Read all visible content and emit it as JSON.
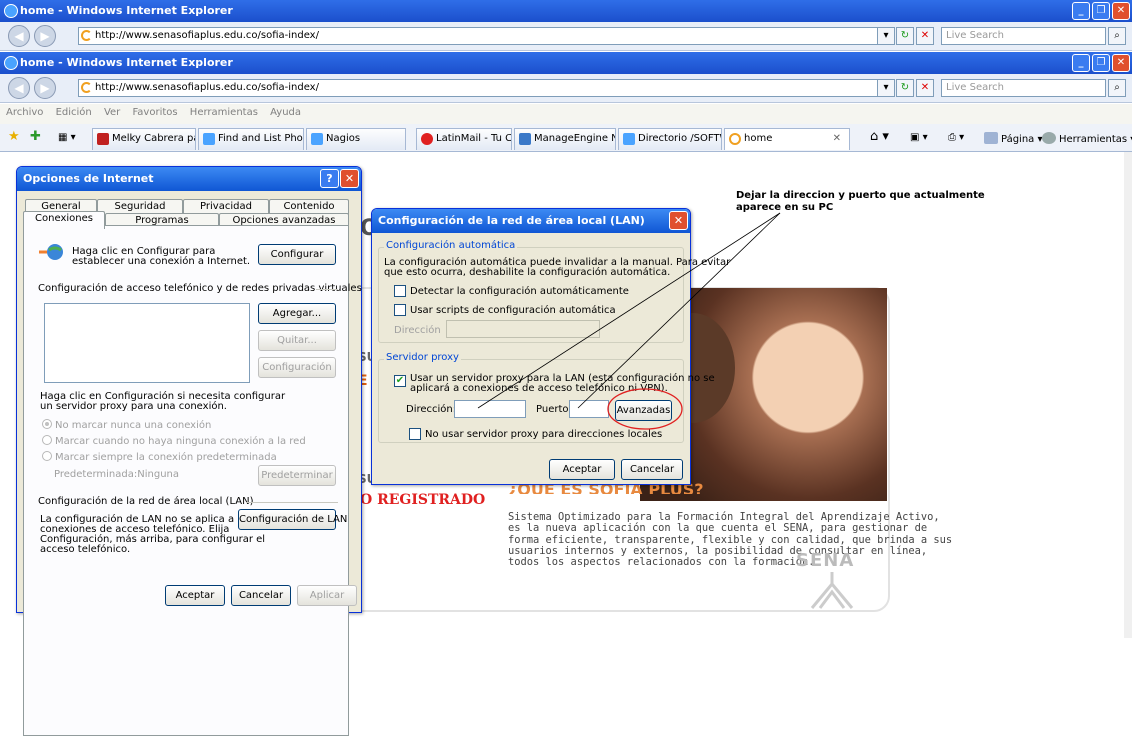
{
  "browser": {
    "title": "home - Windows Internet Explorer",
    "url": "http://www.senasofiaplus.edu.co/sofia-index/",
    "search_placeholder": "Live Search",
    "menu": [
      "Archivo",
      "Edición",
      "Ver",
      "Favoritos",
      "Herramientas",
      "Ayuda"
    ],
    "tabs": [
      "Melky Cabrera pac...",
      "Find and List Phones",
      "Nagios",
      "LatinMail - Tu Corr...",
      "ManageEngine Net...",
      "Directorio /SOFTW...",
      "home"
    ],
    "tools": [
      "Página",
      "Herramientas"
    ]
  },
  "webpage": {
    "heading_red": "O REGISTRADO",
    "heading_sofia": "¿QUÉ ES SOFIA PLUS?",
    "body_lines": [
      "Sistema Optimizado para la Formación Integral del Aprendizaje Activo,",
      "es la nueva aplicación con la que cuenta el SENA, para gestionar de",
      "forma eficiente, transparente, flexible y con calidad, que brinda a sus",
      "usuarios internos y externos, la posibilidad de consultar en línea,",
      "todos los aspectos relacionados con la formación."
    ],
    "sena_logo": "SENA",
    "fragment_o": "O",
    "fragment_su1": "SU",
    "fragment_e": "E",
    "fragment_su2": "SU"
  },
  "annotation": {
    "line1": "Dejar la direccion y puerto que actualmente",
    "line2": "aparece en su PC"
  },
  "inet_options": {
    "title": "Opciones de Internet",
    "tabs_row1": [
      "General",
      "Seguridad",
      "Privacidad",
      "Contenido"
    ],
    "tabs_row2": [
      "Conexiones",
      "Programas",
      "Opciones avanzadas"
    ],
    "setup_line1": "Haga clic en Configurar para",
    "setup_line2": "establecer una conexión a Internet.",
    "configure": "Configurar",
    "dialup_header": "Configuración de acceso telefónico y de redes privadas virtuales",
    "add": "Agregar...",
    "remove": "Quitar...",
    "settings": "Configuración",
    "proxy_hint1": "Haga clic en Configuración si necesita configurar",
    "proxy_hint2": "un servidor proxy para una conexión.",
    "radio1": "No marcar nunca una conexión",
    "radio2": "Marcar cuando no haya ninguna conexión a la red",
    "radio3": "Marcar siempre la conexión predeterminada",
    "default_label": "Predeterminada:",
    "default_value": "Ninguna",
    "set_default": "Predeterminar",
    "lan_header": "Configuración de la red de área local (LAN)",
    "lan_line1": "La configuración de LAN no se aplica a las",
    "lan_line2": "conexiones de acceso telefónico. Elija",
    "lan_line3": "Configuración, más arriba, para configurar el",
    "lan_line4": "acceso telefónico.",
    "lan_button": "Configuración de LAN",
    "ok": "Aceptar",
    "cancel": "Cancelar",
    "apply": "Aplicar"
  },
  "lan_dialog": {
    "title": "Configuración de la red de área local (LAN)",
    "auto_group": "Configuración automática",
    "auto_desc1": "La configuración automática puede invalidar a la manual. Para evitar",
    "auto_desc2": "que esto ocurra, deshabilite la configuración automática.",
    "detect": "Detectar la configuración automáticamente",
    "use_scripts": "Usar scripts de configuración automática",
    "address_label": "Dirección",
    "proxy_group": "Servidor proxy",
    "use_proxy1": "Usar un servidor proxy para la LAN (esta configuración no se",
    "use_proxy2": "aplicará a conexiones de acceso telefónico ni VPN).",
    "proxy_address_label": "Dirección:",
    "proxy_address_value": "",
    "port_label": "Puerto:",
    "port_value": "",
    "advanced": "Avanzadas",
    "bypass_local": "No usar servidor proxy para direcciones locales",
    "ok": "Aceptar",
    "cancel": "Cancelar"
  },
  "colors": {
    "accent_red": "#e02020",
    "title_blue": "#0f56d4",
    "sena_green": "#2c8a3d"
  }
}
